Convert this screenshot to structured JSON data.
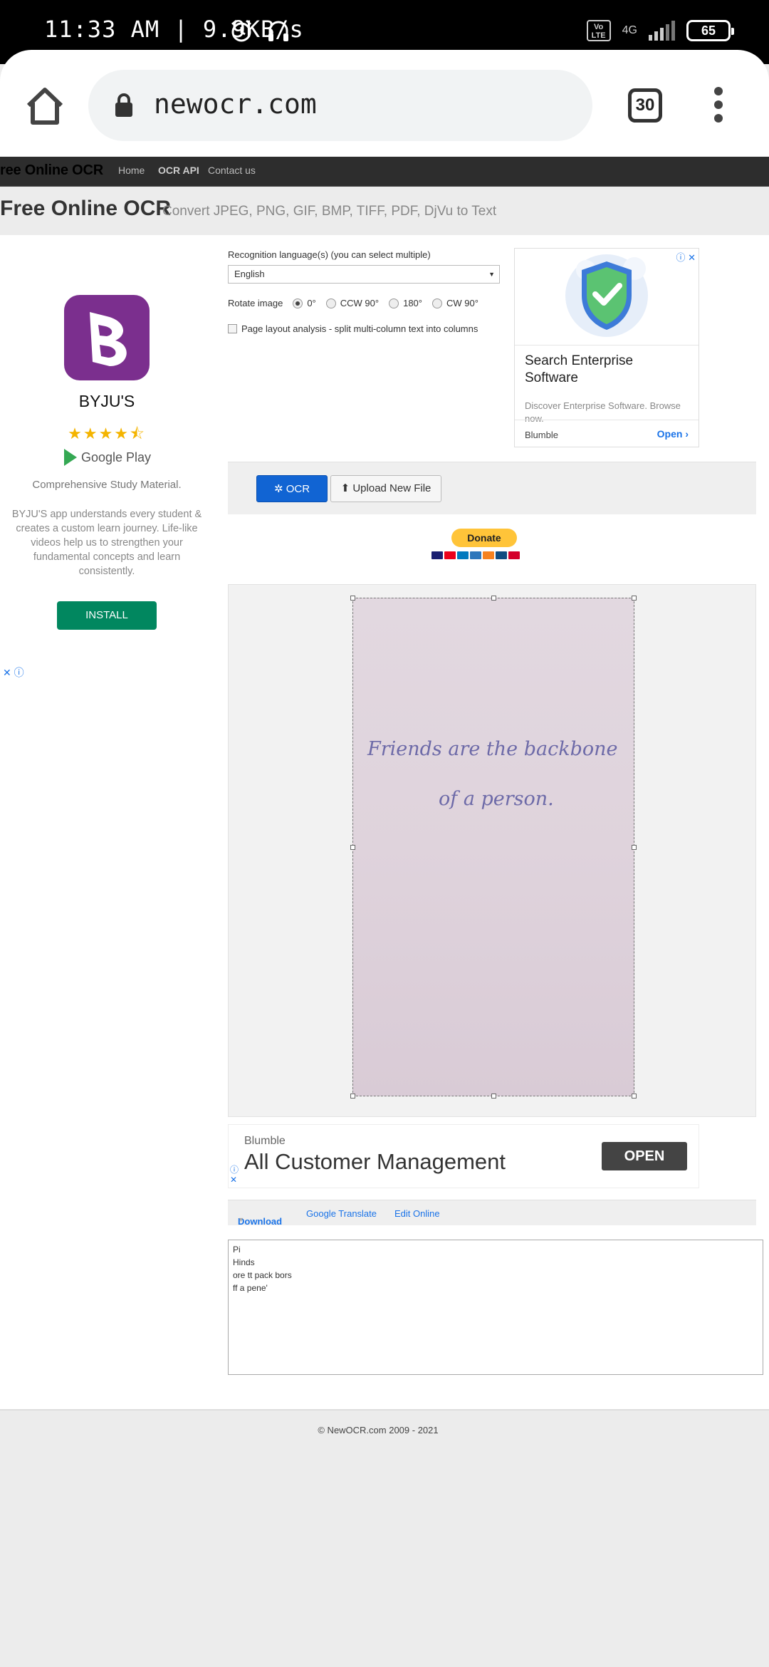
{
  "status_bar": {
    "time_text": "11:33 AM | 9.9KB/s",
    "volte_label": "Vo LTE",
    "network_label": "4G",
    "battery_level": "65"
  },
  "browser": {
    "url": "newocr.com",
    "tab_count": "30"
  },
  "site_nav": {
    "brand": "ree Online OCR",
    "links": [
      "Home",
      "OCR API",
      "Contact us"
    ]
  },
  "hero": {
    "title": "Free Online OCR",
    "subtitle": "Convert JPEG, PNG, GIF, BMP, TIFF, PDF, DjVu to Text"
  },
  "ad_left": {
    "app_name": "BYJU'S",
    "rating_stars": "★★★★⯪",
    "store_label": "Google Play",
    "tagline": "Comprehensive Study Material.",
    "description": "BYJU'S app understands every student & creates a custom learn journey. Life-like videos help us to strengthen your fundamental concepts and learn consistently.",
    "install_label": "INSTALL"
  },
  "form": {
    "language_label": "Recognition language(s) (you can select multiple)",
    "language_value": "English",
    "rotate_label": "Rotate image",
    "rotate_options": [
      "0°",
      "CCW 90°",
      "180°",
      "CW 90°"
    ],
    "rotate_selected": "0°",
    "layout_label": "Page layout analysis - split multi-column text into columns",
    "layout_checked": false
  },
  "ad_right": {
    "headline": "Search Enterprise Software",
    "description": "Discover Enterprise Software. Browse now.",
    "advertiser": "Blumble",
    "open_label": "Open"
  },
  "actions": {
    "ocr_label": "OCR",
    "upload_label": "Upload New File"
  },
  "donate": {
    "label": "Donate"
  },
  "image": {
    "line1": "Friends are the backbone",
    "line2": "of a person."
  },
  "ad_bottom": {
    "advertiser": "Blumble",
    "headline": "All Customer Management",
    "open_label": "OPEN"
  },
  "result_toolbar": {
    "download_label": "Download",
    "translate_label": "Google Translate",
    "edit_label": "Edit Online"
  },
  "result_lines": [
    "Pi",
    "Hinds",
    "ore tt pack bors",
    "ff a pene'"
  ],
  "footer": {
    "copyright": "© NewOCR.com 2009 - 2021"
  },
  "colors": {
    "ocr_button": "#1164d3",
    "install_button": "#01875f",
    "donate_button": "#ffc439",
    "nav_background": "#2d2d2d",
    "app_icon": "#7b2f8e"
  }
}
